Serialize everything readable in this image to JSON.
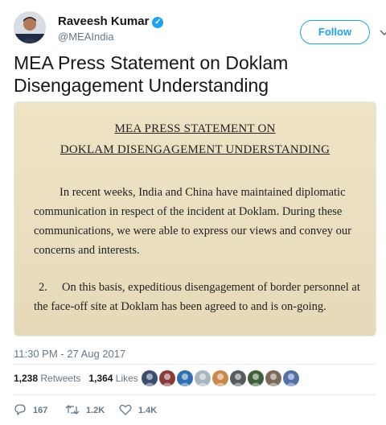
{
  "header": {
    "name": "Raveesh Kumar",
    "handle": "@MEAIndia",
    "follow_label": "Follow"
  },
  "tweet": {
    "text": "MEA Press Statement on Doklam Disengagement Understanding",
    "timestamp": "11:30 PM - 27 Aug 2017"
  },
  "document": {
    "title_line1": "MEA PRESS STATEMENT ON",
    "title_line2": "DOKLAM DISENGAGEMENT UNDERSTANDING",
    "para1": "In recent weeks, India and China have maintained diplomatic communication in respect of the incident at Doklam. During these communications, we were able to express our views and convey our concerns and interests.",
    "para2_number": "2.",
    "para2": "On this basis, expeditious disengagement of border personnel at the face-off site at Doklam has been agreed to and is on-going."
  },
  "stats": {
    "retweets_count": "1,238",
    "retweets_label": "Retweets",
    "likes_count": "1,364",
    "likes_label": "Likes"
  },
  "likers": [
    {
      "icon": "avatar-1",
      "color": "#3b4c6b"
    },
    {
      "icon": "avatar-2",
      "color": "#8a3a3a"
    },
    {
      "icon": "avatar-3",
      "color": "#2d6fb0"
    },
    {
      "icon": "avatar-4",
      "color": "#aab4bd"
    },
    {
      "icon": "avatar-5",
      "color": "#c88a4a"
    },
    {
      "icon": "avatar-6",
      "color": "#555c5f"
    },
    {
      "icon": "avatar-7",
      "color": "#3f5f3a"
    },
    {
      "icon": "avatar-8",
      "color": "#7a6a5a"
    },
    {
      "icon": "avatar-9",
      "color": "#5470a8"
    }
  ],
  "actions": {
    "reply_count": "167",
    "retweet_count": "1.2K",
    "like_count": "1.4K"
  },
  "colors": {
    "accent": "#1da1f2",
    "muted": "#657786",
    "paper": "#eee3c5"
  }
}
